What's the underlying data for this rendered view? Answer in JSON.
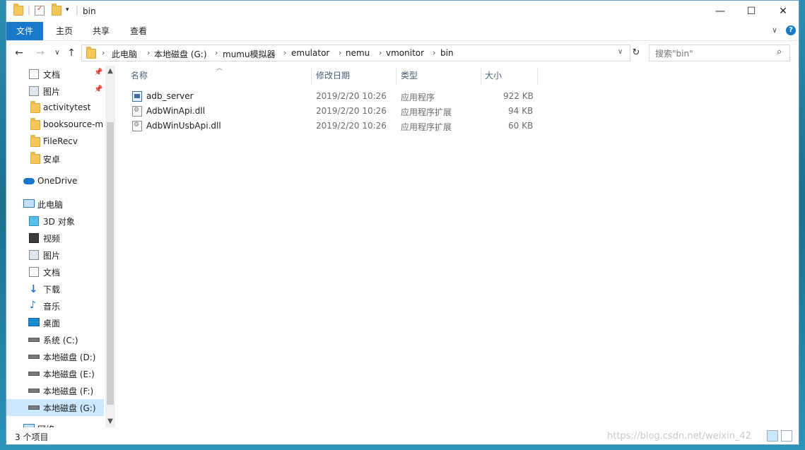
{
  "window": {
    "title": "bin",
    "min_glyph": "—",
    "max_glyph": "☐",
    "close_glyph": "✕"
  },
  "ribbon": {
    "tabs": [
      "文件",
      "主页",
      "共享",
      "查看"
    ],
    "expand_glyph": "∨",
    "help_glyph": "?"
  },
  "nav_buttons": {
    "back": "←",
    "forward": "→",
    "history": "∨",
    "up": "↑",
    "refresh": "↻",
    "dropdown": "∨"
  },
  "breadcrumb": [
    "此电脑",
    "本地磁盘 (G:)",
    "mumu模拟器",
    "emulator",
    "nemu",
    "vmonitor",
    "bin"
  ],
  "search": {
    "placeholder": "搜索\"bin\"",
    "icon": "search-icon"
  },
  "nav_pane": {
    "items": [
      {
        "label": "文档",
        "icon": "documents-icon",
        "pinned": true
      },
      {
        "label": "图片",
        "icon": "pictures-icon",
        "pinned": true
      },
      {
        "label": "activitytest",
        "icon": "folder-icon"
      },
      {
        "label": "booksource-m",
        "icon": "folder-icon"
      },
      {
        "label": "FileRecv",
        "icon": "folder-icon"
      },
      {
        "label": "安卓",
        "icon": "folder-icon"
      },
      {
        "label": "OneDrive",
        "icon": "onedrive-icon"
      },
      {
        "label": "此电脑",
        "icon": "this-pc-icon"
      },
      {
        "label": "3D 对象",
        "icon": "3d-objects-icon"
      },
      {
        "label": "视频",
        "icon": "videos-icon"
      },
      {
        "label": "图片",
        "icon": "pictures-icon"
      },
      {
        "label": "文档",
        "icon": "documents-icon"
      },
      {
        "label": "下载",
        "icon": "downloads-icon"
      },
      {
        "label": "音乐",
        "icon": "music-icon"
      },
      {
        "label": "桌面",
        "icon": "desktop-icon"
      },
      {
        "label": "系统 (C:)",
        "icon": "system-drive-icon"
      },
      {
        "label": "本地磁盘 (D:)",
        "icon": "drive-icon"
      },
      {
        "label": "本地磁盘 (E:)",
        "icon": "drive-icon"
      },
      {
        "label": "本地磁盘 (F:)",
        "icon": "drive-icon"
      },
      {
        "label": "本地磁盘 (G:)",
        "icon": "drive-icon",
        "selected": true
      },
      {
        "label": "网络",
        "icon": "network-icon"
      }
    ],
    "pin_glyph": "📌"
  },
  "columns": [
    "名称",
    "修改日期",
    "类型",
    "大小"
  ],
  "files": [
    {
      "name": "adb_server",
      "modified": "2019/2/20 10:26",
      "type": "应用程序",
      "size": "922 KB",
      "icon": "exe-icon"
    },
    {
      "name": "AdbWinApi.dll",
      "modified": "2019/2/20 10:26",
      "type": "应用程序扩展",
      "size": "94 KB",
      "icon": "dll-icon"
    },
    {
      "name": "AdbWinUsbApi.dll",
      "modified": "2019/2/20 10:26",
      "type": "应用程序扩展",
      "size": "60 KB",
      "icon": "dll-icon"
    }
  ],
  "status": {
    "count": "3 个项目",
    "watermark": "https://blog.csdn.net/weixin_42"
  },
  "colors": {
    "accent": "#1979ca",
    "selection": "#cce8ff",
    "folder": "#f4c95a",
    "header_text": "#4c607a"
  }
}
